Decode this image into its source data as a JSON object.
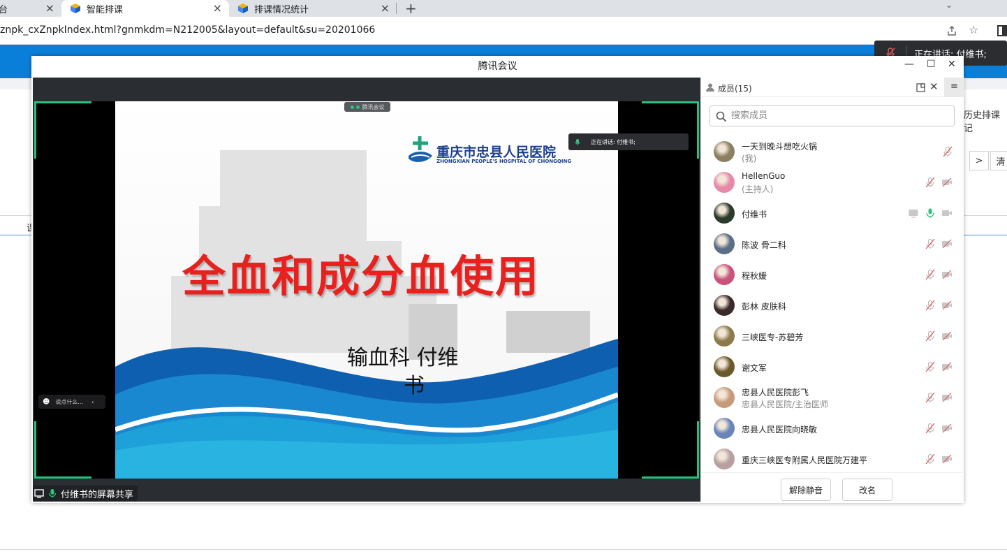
{
  "browser": {
    "tabs": [
      {
        "label": "台"
      },
      {
        "label": "智能排课"
      },
      {
        "label": "排课情况统计"
      }
    ],
    "new_tab": "+",
    "url": "znpk_cxZnpkIndex.html?gnmkdm=N212005&layout=default&su=20201066"
  },
  "background_page": {
    "right_label": "历史排课记",
    "pager_next": ">",
    "pager_clear": "清",
    "left_fragment": "课"
  },
  "toast": {
    "text": "正在讲话: 付维书;"
  },
  "meeting": {
    "window_title": "腾讯会议",
    "share_badge": "腾讯会议",
    "speaking_overlay": "正在讲话: 付维书;",
    "chat_placeholder": "说点什么...",
    "share_label": "付维书的屏幕共享",
    "slide": {
      "hospital_name": "重庆市忠县人民医院",
      "hospital_name_en": "ZHONGXIAN PEOPLE'S HOSPITAL OF CHONGQING",
      "title": "全血和成分血使用",
      "subtitle_line1": "输血科   付维",
      "subtitle_line2": "书"
    }
  },
  "members_panel": {
    "title": "成员(15)",
    "search_placeholder": "搜索成员",
    "members": [
      {
        "name": "一天到晚斗想吃火锅",
        "role": "(我)",
        "avatar_color": "#8a8060",
        "mic": "muted",
        "cam": "none"
      },
      {
        "name": "HellenGuo",
        "role": "(主持人)",
        "avatar_color": "#e58aa8",
        "mic": "muted",
        "cam": "off"
      },
      {
        "name": "付维书",
        "role": "",
        "avatar_color": "#2c3a2a",
        "mic": "on",
        "cam": "off",
        "sharing": true
      },
      {
        "name": "陈波 骨二科",
        "role": "",
        "avatar_color": "#5b6e85",
        "mic": "muted",
        "cam": "off"
      },
      {
        "name": "程秋媛",
        "role": "",
        "avatar_color": "#c8547a",
        "mic": "muted",
        "cam": "off"
      },
      {
        "name": "彭林 皮肤科",
        "role": "",
        "avatar_color": "#3a2a28",
        "mic": "muted",
        "cam": "off"
      },
      {
        "name": "三峡医专-苏碧芳",
        "role": "",
        "avatar_color": "#8c7a4c",
        "mic": "muted",
        "cam": "off"
      },
      {
        "name": "谢文军",
        "role": "",
        "avatar_color": "#6a5a2a",
        "mic": "muted",
        "cam": "off"
      },
      {
        "name": "忠县人民医院彭飞",
        "role": "忠县人民医院/主治医师",
        "avatar_color": "#c79a7a",
        "mic": "muted",
        "cam": "off"
      },
      {
        "name": "忠县人民医院向晓敏",
        "role": "",
        "avatar_color": "#6a86b8",
        "mic": "muted",
        "cam": "off"
      },
      {
        "name": "重庆三峡医专附属人民医院万建平",
        "role": "",
        "avatar_color": "#b8a0a0",
        "mic": "muted",
        "cam": "off"
      }
    ],
    "unmute_button": "解除静音",
    "rename_button": "改名"
  }
}
